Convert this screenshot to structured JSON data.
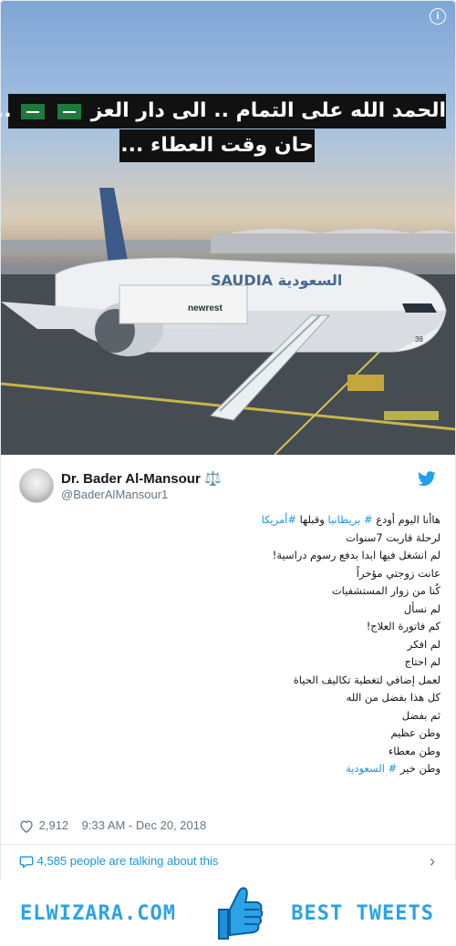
{
  "photo": {
    "banner_line1": "الحمد الله على التمام .. الى دار العز",
    "banner_line1_end": "..",
    "banner_line2": "حان وقت العطاء ...",
    "flag_icon": "saudi-flag",
    "aircraft_livery": "SAUDIA السعودية",
    "tail_number": "38",
    "catering_truck_label": "newrest",
    "info_icon": "i"
  },
  "author": {
    "name": "Dr. Bader Al-Mansour",
    "badge": "⚖️",
    "handle": "@BaderAlMansour1"
  },
  "tweet": {
    "lines": [
      {
        "before": "هاأنا اليوم أودع ",
        "hash1": "# بريطانيا",
        "mid": " وقبلها ",
        "hash2": "#أمريكا",
        "after": ""
      },
      {
        "text": "لرحلة قاربت 7سنوات"
      },
      {
        "text": "لم انشغل فيها ابدا بدفع رسوم دراسية!"
      },
      {
        "text": "عانت زوجتي مؤخراً"
      },
      {
        "text": "كُنا من زوار المستشفيات"
      },
      {
        "text": "لم نسأل"
      },
      {
        "text": "كم فاتورة العلاج!"
      },
      {
        "text": "لم افكر"
      },
      {
        "text": "لم احتاج"
      },
      {
        "text": "لعمل إضافي لتغطية تكاليف الحياة"
      },
      {
        "text": "كل هذا بفضل من الله"
      },
      {
        "text": "ثم بفضل"
      },
      {
        "text": "وطن عظيم"
      },
      {
        "text": "وطن معطاء"
      },
      {
        "before": "وطن خير ",
        "hash1": "# السعودية"
      }
    ]
  },
  "meta": {
    "likes": "2,912",
    "timestamp": "9:33 AM - Dec 20, 2018",
    "talking": "4,585 people are talking about this"
  },
  "footer": {
    "left_brand": "ELWIZARA.COM",
    "right_brand": "BEST TWEETS"
  },
  "colors": {
    "link": "#1b95e0",
    "brand": "#2aa3e8",
    "banner_bg": "#111111"
  }
}
